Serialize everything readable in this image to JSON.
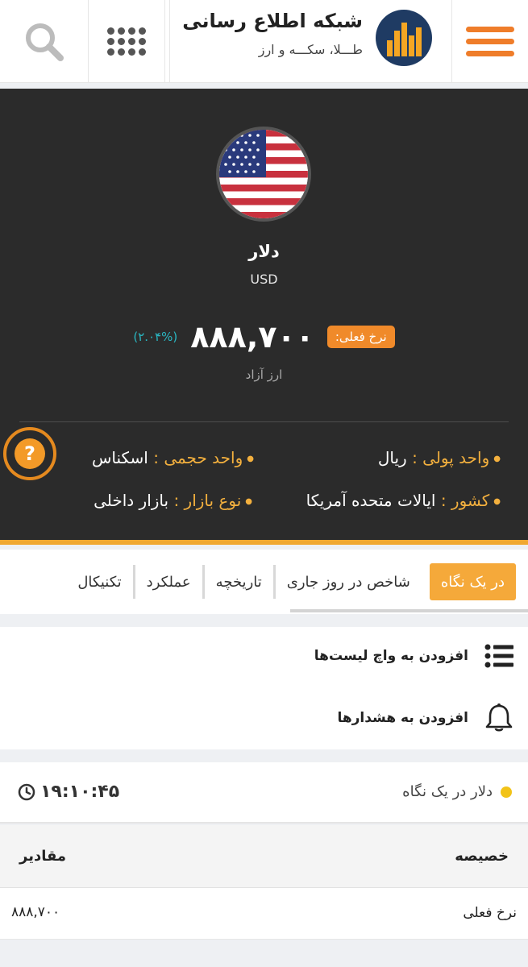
{
  "header": {
    "brand_title": "شبکه اطلاع رسانی",
    "brand_subtitle": "طـــلا، سکـــه و ارز"
  },
  "currency": {
    "name": "دلار",
    "code": "USD",
    "rate_label": "نرخ فعلی:",
    "rate_value": "۸۸۸,۷۰۰",
    "change": "(۲.۰۴%)",
    "market_type": "ارز آزاد"
  },
  "details": {
    "unit_label": "واحد پولی :",
    "unit_value": "ریال",
    "volume_label": "واحد حجمی :",
    "volume_value": "اسکناس",
    "country_label": "کشور :",
    "country_value": "ایالات متحده آمریکا",
    "market_label": "نوع بازار :",
    "market_value": "بازار داخلی"
  },
  "tabs": [
    {
      "label": "در یک نگاه"
    },
    {
      "label": "شاخص در روز جاری"
    },
    {
      "label": "تاریخچه"
    },
    {
      "label": "عملکرد"
    },
    {
      "label": "تکنیکال"
    }
  ],
  "actions": {
    "watchlist": "افزودن به واچ لیست‌ها",
    "alerts": "افزودن به هشدارها"
  },
  "glance": {
    "title": "دلار در یک نگاه",
    "time": "۱۹:۱۰:۴۵"
  },
  "table": {
    "col_feature": "خصیصه",
    "col_values": "مقادیر",
    "rows": [
      {
        "feature": "نرخ فعلی",
        "value": "۸۸۸,۷۰۰"
      }
    ]
  },
  "colors": {
    "accent_orange": "#f08a2a",
    "tab_active": "#f5a93a",
    "change_teal": "#2ab7c2",
    "hero_bg": "#2b2b2b"
  }
}
